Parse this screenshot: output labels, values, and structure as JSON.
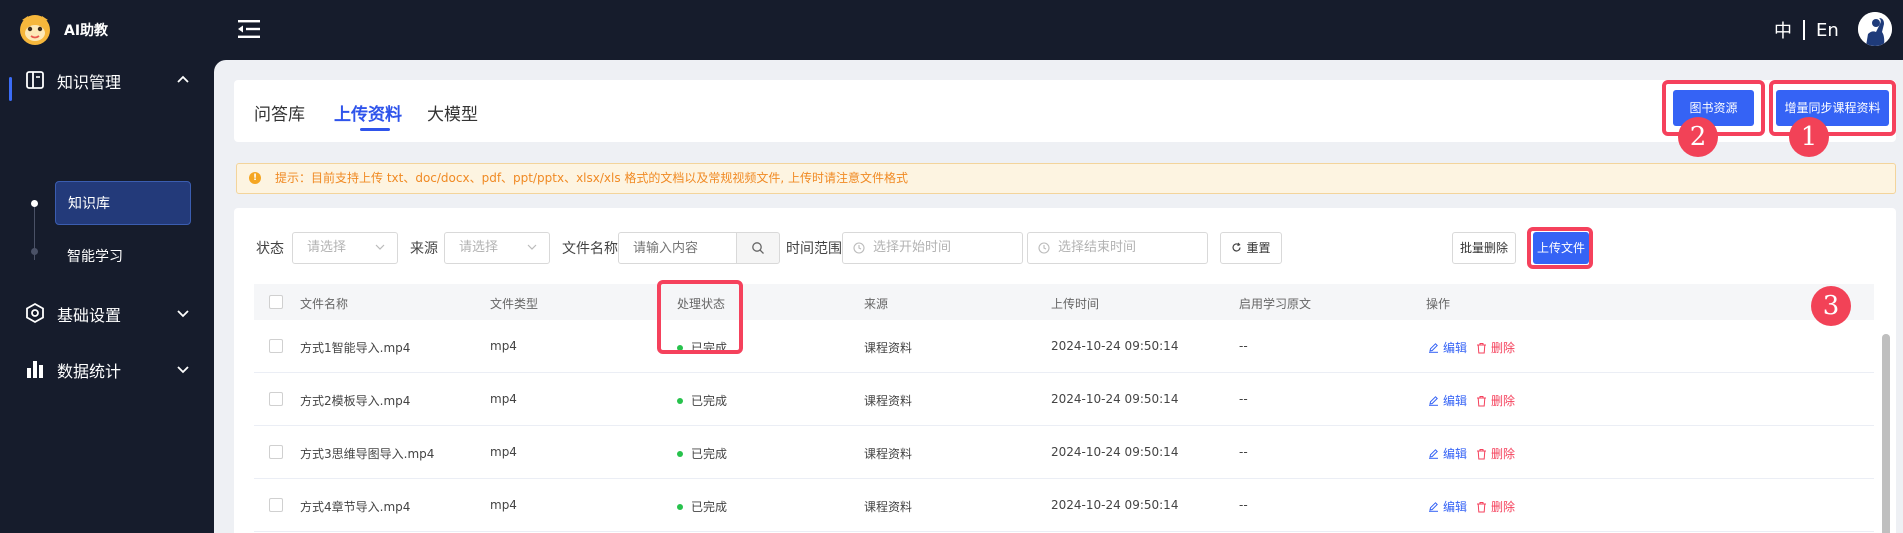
{
  "app": {
    "title": "AI助教"
  },
  "header": {
    "lang_zh": "中",
    "lang_en": "En"
  },
  "sidebar": {
    "groups": [
      {
        "label": "知识管理",
        "icon": "book-icon",
        "expanded": true,
        "items": [
          {
            "label": "知识库",
            "active": true
          },
          {
            "label": "智能学习",
            "active": false
          }
        ]
      },
      {
        "label": "基础设置",
        "icon": "settings-icon",
        "expanded": false
      },
      {
        "label": "数据统计",
        "icon": "bar-chart-icon",
        "expanded": false
      }
    ]
  },
  "tabs": [
    {
      "label": "问答库",
      "active": false
    },
    {
      "label": "上传资料",
      "active": true
    },
    {
      "label": "大模型",
      "active": false
    }
  ],
  "actions": {
    "book_resources": "图书资源",
    "sync_course": "增量同步课程资料"
  },
  "annotations": [
    "1",
    "2",
    "3"
  ],
  "tip": {
    "text": "提示：目前支持上传 txt、doc/docx、pdf、ppt/pptx、xlsx/xls 格式的文档以及常规视频文件, 上传时请注意文件格式"
  },
  "filters": {
    "status_label": "状态",
    "status_placeholder": "请选择",
    "source_label": "来源",
    "source_placeholder": "请选择",
    "filename_label": "文件名称",
    "filename_placeholder": "请输入内容",
    "time_label": "时间范围",
    "start_placeholder": "选择开始时间",
    "end_placeholder": "选择结束时间",
    "reset": "重置",
    "batch_delete": "批量删除",
    "upload": "上传文件"
  },
  "table": {
    "headers": [
      "文件名称",
      "文件类型",
      "处理状态",
      "来源",
      "上传时间",
      "启用学习原文",
      "操作"
    ],
    "rows": [
      {
        "name": "方式1智能导入.mp4",
        "type": "mp4",
        "status": "已完成",
        "source": "课程资料",
        "time": "2024-10-24 09:50:14",
        "learn": "--"
      },
      {
        "name": "方式2模板导入.mp4",
        "type": "mp4",
        "status": "已完成",
        "source": "课程资料",
        "time": "2024-10-24 09:50:14",
        "learn": "--"
      },
      {
        "name": "方式3思维导图导入.mp4",
        "type": "mp4",
        "status": "已完成",
        "source": "课程资料",
        "time": "2024-10-24 09:50:14",
        "learn": "--"
      },
      {
        "name": "方式4章节导入.mp4",
        "type": "mp4",
        "status": "已完成",
        "source": "课程资料",
        "time": "2024-10-24 09:50:14",
        "learn": "--"
      }
    ],
    "edit_label": "编辑",
    "delete_label": "删除"
  },
  "colors": {
    "primary": "#3563f5",
    "highlight": "#f5415c",
    "success": "#27c24c",
    "sidebar_bg": "#161c2c"
  }
}
